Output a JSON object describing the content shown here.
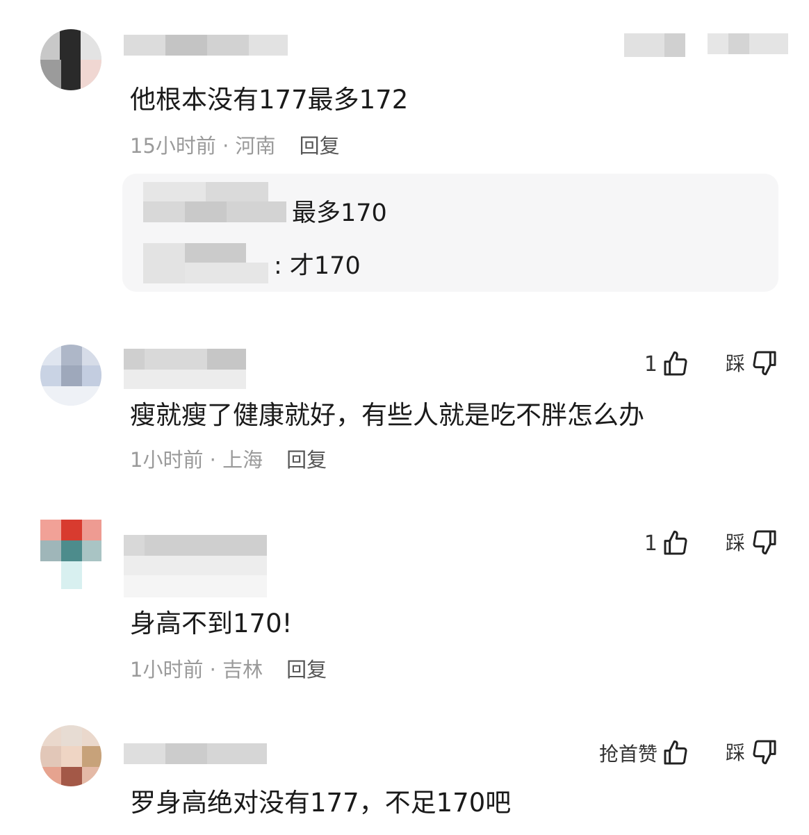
{
  "comments": [
    {
      "text": "他根本没有177最多172",
      "time": "15小时前 · 河南",
      "reply_label": "回复",
      "replies": [
        {
          "text": "最多170"
        },
        {
          "text": ": 才170"
        }
      ]
    },
    {
      "text": "瘦就瘦了健康就好，有些人就是吃不胖怎么办",
      "time": "1小时前 · 上海",
      "reply_label": "回复",
      "like_count": "1",
      "dislike_label": "踩"
    },
    {
      "text": "身高不到170!",
      "time": "1小时前 · 吉林",
      "reply_label": "回复",
      "like_count": "1",
      "dislike_label": "踩"
    },
    {
      "text": "罗身高绝对没有177，不足170吧",
      "like_label": "抢首赞",
      "dislike_label": "踩"
    }
  ],
  "icons": [
    "thumbs-up-icon",
    "thumbs-down-icon"
  ],
  "colors": {
    "text": "#1a1a1a",
    "meta": "#9a9a9a",
    "reply_bg": "#f6f6f7"
  }
}
